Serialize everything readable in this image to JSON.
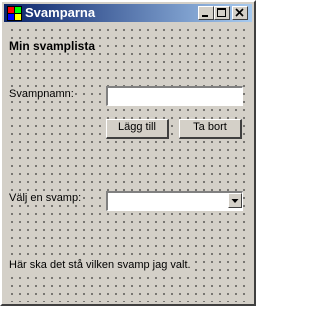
{
  "window": {
    "title": "Svamparna",
    "icon": "app-window-icon"
  },
  "caption_buttons": [
    {
      "name": "minimize",
      "icon": "minimize-icon"
    },
    {
      "name": "maximize",
      "icon": "maximize-icon"
    },
    {
      "name": "close",
      "icon": "close-icon"
    }
  ],
  "form": {
    "heading": "Min svamplista",
    "name_label": "Svampnamn:",
    "name_value": "",
    "add_button": "Lägg till",
    "remove_button": "Ta bort",
    "select_label": "Välj en svamp:",
    "select_value": "",
    "result_text": "Här ska det stå vilken svamp jag valt."
  },
  "colors": {
    "titlebar_start": "#0a246a",
    "titlebar_end": "#a6caf0",
    "face": "#d4d0c8"
  }
}
